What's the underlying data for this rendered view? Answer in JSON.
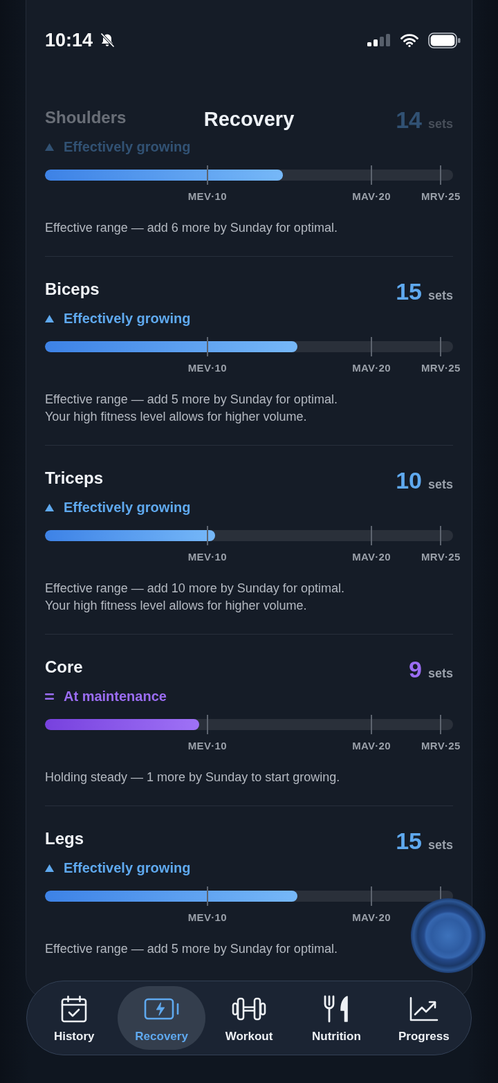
{
  "status_bar": {
    "time": "10:14"
  },
  "header": {
    "title": "Recovery"
  },
  "muscles": [
    {
      "name": "Shoulders",
      "obscured": true,
      "count": "14",
      "unit": "sets",
      "status": {
        "kind": "growing",
        "label": "Effectively growing"
      },
      "level": 0.583,
      "markers": [
        "MEV·10",
        "MAV·20",
        "MRV·25"
      ],
      "notes": [
        "Effective range — add 6 more by Sunday for optimal."
      ]
    },
    {
      "name": "Biceps",
      "obscured": false,
      "count": "15",
      "unit": "sets",
      "status": {
        "kind": "growing",
        "label": "Effectively growing"
      },
      "level": 0.619,
      "markers": [
        "MEV·10",
        "MAV·20",
        "MRV·25"
      ],
      "notes": [
        "Effective range — add 5 more by Sunday for optimal.",
        "Your high fitness level allows for higher volume."
      ]
    },
    {
      "name": "Triceps",
      "obscured": false,
      "count": "10",
      "unit": "sets",
      "status": {
        "kind": "growing",
        "label": "Effectively growing"
      },
      "level": 0.417,
      "markers": [
        "MEV·10",
        "MAV·20",
        "MRV·25"
      ],
      "notes": [
        "Effective range — add 10 more by Sunday for optimal.",
        "Your high fitness level allows for higher volume."
      ]
    },
    {
      "name": "Core",
      "obscured": false,
      "count": "9",
      "unit": "sets",
      "status": {
        "kind": "maintenance",
        "label": "At maintenance"
      },
      "level": 0.378,
      "markers": [
        "MEV·10",
        "MAV·20",
        "MRV·25"
      ],
      "notes": [
        "Holding steady — 1 more by Sunday to start growing."
      ]
    },
    {
      "name": "Legs",
      "obscured": false,
      "count": "15",
      "unit": "sets",
      "status": {
        "kind": "growing",
        "label": "Effectively growing"
      },
      "level": 0.619,
      "markers": [
        "MEV·10",
        "MAV·20"
      ],
      "notes": [
        "Effective range — add 5 more by Sunday for optimal."
      ]
    }
  ],
  "tab_bar": {
    "tabs": [
      {
        "label": "History",
        "selected": false
      },
      {
        "label": "Recovery",
        "selected": true
      },
      {
        "label": "Workout",
        "selected": false
      },
      {
        "label": "Nutrition",
        "selected": false
      },
      {
        "label": "Progress",
        "selected": false
      }
    ]
  }
}
